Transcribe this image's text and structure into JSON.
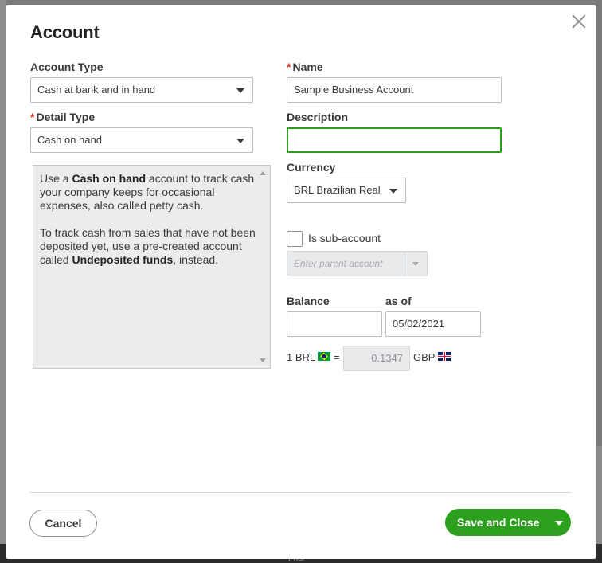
{
  "dialog": {
    "title": "Account"
  },
  "fields": {
    "account_type": {
      "label": "Account Type",
      "value": "Cash at bank and in hand"
    },
    "detail_type": {
      "required_mark": "*",
      "label": "Detail Type",
      "value": "Cash on hand"
    },
    "name": {
      "required_mark": "*",
      "label": "Name",
      "value": "Sample Business Account"
    },
    "description": {
      "label": "Description",
      "value": ""
    },
    "currency": {
      "label": "Currency",
      "value": "BRL Brazilian Real"
    },
    "sub_account": {
      "label": "Is sub-account",
      "checked": false,
      "parent_placeholder": "Enter parent account"
    },
    "balance": {
      "label": "Balance",
      "value": ""
    },
    "as_of": {
      "label": "as of",
      "value": "05/02/2021"
    },
    "exchange_rate": {
      "from_prefix": "1 BRL",
      "equals": "=",
      "rate": "0.1347",
      "to_currency": "GBP",
      "from_flag_icon": "brazil-flag-icon",
      "to_flag_icon": "uk-flag-icon"
    }
  },
  "help_box": {
    "p1_a": "Use a ",
    "p1_b": "Cash on hand",
    "p1_c": " account to track cash your company keeps for occasional expenses, also called petty cash.",
    "p2_a": "To track cash from sales that have not been deposited yet, use a pre-created account called ",
    "p2_b": "Undeposited funds",
    "p2_c": ", instead."
  },
  "footer": {
    "cancel_label": "Cancel",
    "save_label": "Save and Close"
  },
  "background": {
    "bottom_text": "Prior"
  },
  "colors": {
    "primary_green": "#2ca01c",
    "required_red": "#d52b1e",
    "text": "#393a3d"
  }
}
